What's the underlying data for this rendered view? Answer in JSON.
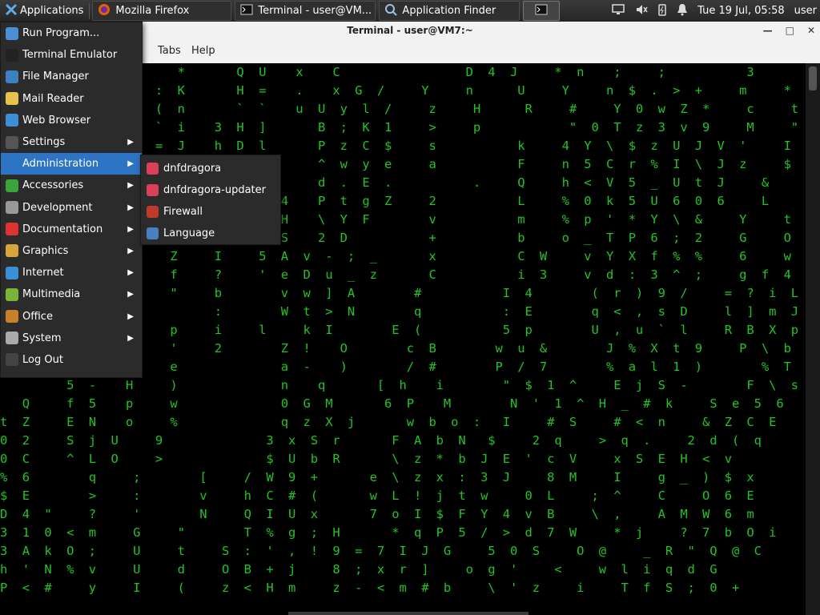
{
  "panel": {
    "applications_label": "Applications",
    "tasks": [
      {
        "label": "Mozilla Firefox",
        "icon": "firefox-icon"
      },
      {
        "label": "Terminal - user@VM...",
        "icon": "terminal-icon"
      },
      {
        "label": "Application Finder",
        "icon": "app-finder-icon"
      }
    ],
    "clock": "Tue 19 Jul, 05:58",
    "user": "user"
  },
  "terminal": {
    "title": "Terminal - user@VM7:~",
    "menu": [
      "l",
      "Tabs",
      "Help"
    ],
    "matrix_lines": [
      "            &    F      *       Q  U    x    C                 D  4  J     *  n    ;     ;           3                  )",
      "            C    P   :  K       H  =    .    x  G  /     Y     n      U     Y     n  $  .  >  +     m     *           t",
      "            h    v   (  n       `  `    u  U  y  l  /     z     H      R     #     Y  0  w  Z  *     c     t           8",
      "            >    7   `  i    3  H  ]       B  ;  K  1     >     p            \"  0  T  z  3  v  9     M     \"           @",
      "            t    R   =  J    h  D  l       P  z  C  $     s           k     4  Y  \\  $  z  U  J  V  '     I           q",
      "                                   #       ^  w  y  e     a           F     n  5  C  r  %  I  \\  J  z     $           `",
      "                                   .       d  .  E  .           .     Q     h  <  V  5  _  U  t  J     &     E  @",
      "                                   a  4    P  t  g  Z     2           L     %  0  k  5  U  6  0  6     L     /",
      "                                   +  H    \\  Y  F        v           m     %  p  '  *  Y  \\  &     Y     t",
      "                                   M  S    2  D           +           b     o  _  T  P  6  ;  2     G     O",
      "            B    V     Z     I     5  A  v  -  ;  _       x           C  W     v  Y  X  f  %  %     6     w",
      "            ]    Q     f     ?     '  e  D  u  _  z       C           i  3     v  d  :  3  ^  ;     g  f  4  '",
      "            -    8     \"     b        v  w  ]  A        #           I  4        (  r  )  9  /     =  ?  i  L",
      "            q    6           :        W  t  >  N        q           :  E        q  <  ,  s  D     l  ]  m  J",
      "            L    \\     p     i     l     k  I        E  (           5  p        U  ,  u  `  l     R  B  X  p",
      "                 =     '     2        Z  !    O        c  B        w  u  &        J  %  X  t  9     P  \\  b  a",
      "                 V     e              a  -    )        /  #        P  /  7        %  a  l  1  )        %  T  P",
      "         5  -    H     )              n    q       [  h    i        \"  $  1  ^     E  j  S  -        F  \\  s",
      "   Q     f  5    p     w              0  G  M       6  P    M        N  '  1  ^  H  _  #  k     S  e  5  6",
      "t  Z     E  N    o     %              q  z  X  j       w  b  o  :   I     #  S     #  <  n     &  Z  C  E",
      "0  2     S  j  U     9              3  x  S  r       F  A  b  N   $     2  q     >  q  .     2  d  (  q",
      "0  C     ^  L  O     >              $  U  b  R       \\  z  *  b  J  E  '  c  V     x  S  E  H  <  v",
      "%  6        q     ;        [     /  W  9  +       e  \\  z  x  :  3  J     8  M     I     g  _  )  $  x",
      "$  E        >     :        v     h  C  #  (       w  L  !  j  t  w     0  L     ;  ^     C     O  6  E",
      "D  4  \"     ?     '        N     Q  I  U  x       7  o  I  $  F  Y  4  v  B     \\  ,     A  M  W  6  m",
      "3  1  0  <  m     G     \"        T  %  g  ;  H       *  q  P  5  /  >  d  7  W     *  j     ?  7  b  O  i",
      "3  A  k  O  ;     U     t     S  :  '  ,  !  9  =  7  I  J  G     5  0  S     O  @     _  R  \"  Q  @  C",
      "h  '  N  %  v     U     d     O  B  +  j     8  ;  x  r  ]     o  g  '     <     w  l  i  q  d  G",
      "P  <  #     y     I     (     z  <  H  m     z  -  <  m  #  b     \\  '  z     i     T  f  S  ;  0  +"
    ]
  },
  "app_menu": {
    "items": [
      {
        "label": "Run Program...",
        "icon": "run-program-icon",
        "submenu": false
      },
      {
        "label": "Terminal Emulator",
        "icon": "terminal-emulator-icon",
        "submenu": false
      },
      {
        "label": "File Manager",
        "icon": "file-manager-icon",
        "submenu": false
      },
      {
        "label": "Mail Reader",
        "icon": "mail-reader-icon",
        "submenu": false
      },
      {
        "label": "Web Browser",
        "icon": "web-browser-icon",
        "submenu": false
      },
      {
        "label": "Settings",
        "icon": "settings-icon",
        "submenu": true
      },
      {
        "label": "Administration",
        "icon": "administration-icon",
        "submenu": true
      },
      {
        "label": "Accessories",
        "icon": "accessories-icon",
        "submenu": true
      },
      {
        "label": "Development",
        "icon": "development-icon",
        "submenu": true
      },
      {
        "label": "Documentation",
        "icon": "documentation-icon",
        "submenu": true
      },
      {
        "label": "Graphics",
        "icon": "graphics-icon",
        "submenu": true
      },
      {
        "label": "Internet",
        "icon": "internet-icon",
        "submenu": true
      },
      {
        "label": "Multimedia",
        "icon": "multimedia-icon",
        "submenu": true
      },
      {
        "label": "Office",
        "icon": "office-icon",
        "submenu": true
      },
      {
        "label": "System",
        "icon": "system-icon",
        "submenu": true
      },
      {
        "label": "Log Out",
        "icon": "log-out-icon",
        "submenu": false
      }
    ],
    "highlighted": "Administration",
    "submenu_items": [
      {
        "label": "dnfdragora",
        "icon": "dnfdragora-icon"
      },
      {
        "label": "dnfdragora-updater",
        "icon": "dnfdragora-updater-icon"
      },
      {
        "label": "Firewall",
        "icon": "firewall-icon"
      },
      {
        "label": "Language",
        "icon": "language-icon"
      }
    ]
  },
  "colors": {
    "matrix_green": "#22c322",
    "highlight": "#2d74c4",
    "menu_bg": "#2b2b2b"
  }
}
